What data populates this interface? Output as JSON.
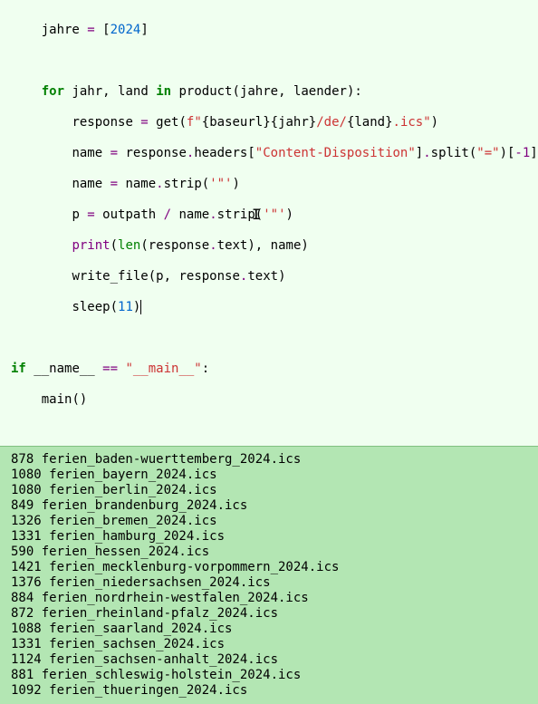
{
  "code": {
    "l1": {
      "indent": "    ",
      "name": "jahre",
      "eq": " = ",
      "lb": "[",
      "num": "2024",
      "rb": "]"
    },
    "l2": {
      "indent": "    ",
      "for": "for",
      "sp": " ",
      "v1": "jahr",
      "comma": ", ",
      "v2": "land",
      "sp2": " ",
      "in": "in",
      "sp3": " ",
      "fn": "product",
      "lp": "(",
      "a1": "jahre",
      "c2": ", ",
      "a2": "laender",
      "rp": "):"
    },
    "l3": {
      "indent": "        ",
      "name": "response",
      "eq": " = ",
      "fn": "get",
      "lp": "(",
      "f": "f",
      "q1": "\"",
      "s1": "{baseurl}{jahr}",
      "s2": "/de/",
      "s3": "{land}",
      "s4": ".ics",
      "q2": "\"",
      "rp": ")"
    },
    "l4": {
      "indent": "        ",
      "name": "name",
      "eq": " = ",
      "obj": "response",
      "dot1": ".",
      "attr": "headers",
      "lb": "[",
      "key": "\"Content-Disposition\"",
      "rb": "]",
      "dot2": ".",
      "m": "split",
      "lp": "(",
      "arg": "\"=\"",
      "rp": ")[",
      "idx": "-1",
      "rb2": "]"
    },
    "l5": {
      "indent": "        ",
      "name": "name",
      "eq": " = ",
      "obj": "name",
      "dot": ".",
      "m": "strip",
      "lp": "(",
      "arg": "'\"'",
      "rp": ")"
    },
    "l6": {
      "indent": "        ",
      "name": "p",
      "eq": " = ",
      "obj": "outpath",
      "op": " / ",
      "obj2": "name",
      "dot": ".",
      "m": "strip",
      "lp": "(",
      "arg": "'\"'",
      "rp": ")"
    },
    "l7": {
      "indent": "        ",
      "fn": "print",
      "lp": "(",
      "len": "len",
      "lp2": "(",
      "a1": "response",
      "dot": ".",
      "a2": "text",
      "rp2": ")",
      "c": ", ",
      "a3": "name",
      "rp": ")"
    },
    "l8": {
      "indent": "        ",
      "fn": "write_file",
      "lp": "(",
      "a1": "p",
      "c": ", ",
      "a2": "response",
      "dot": ".",
      "a3": "text",
      "rp": ")"
    },
    "l9": {
      "indent": "        ",
      "fn": "sleep",
      "lp": "(",
      "num": "11",
      "rp": ")"
    },
    "l10": {
      "if": "if",
      "sp": " ",
      "d1": "__name__",
      "eq": " == ",
      "str": "\"__main__\"",
      "colon": ":"
    },
    "l11": {
      "indent": "    ",
      "fn": "main",
      "lp": "(",
      "rp": ")"
    }
  },
  "output": [
    "878 ferien_baden-wuerttemberg_2024.ics",
    "1080 ferien_bayern_2024.ics",
    "1080 ferien_berlin_2024.ics",
    "849 ferien_brandenburg_2024.ics",
    "1326 ferien_bremen_2024.ics",
    "1331 ferien_hamburg_2024.ics",
    "590 ferien_hessen_2024.ics",
    "1421 ferien_mecklenburg-vorpommern_2024.ics",
    "1376 ferien_niedersachsen_2024.ics",
    "884 ferien_nordrhein-westfalen_2024.ics",
    "872 ferien_rheinland-pfalz_2024.ics",
    "1088 ferien_saarland_2024.ics",
    "1331 ferien_sachsen_2024.ics",
    "1124 ferien_sachsen-anhalt_2024.ics",
    "881 ferien_schleswig-holstein_2024.ics",
    "1092 ferien_thueringen_2024.ics"
  ],
  "cursor_glyph": "I"
}
